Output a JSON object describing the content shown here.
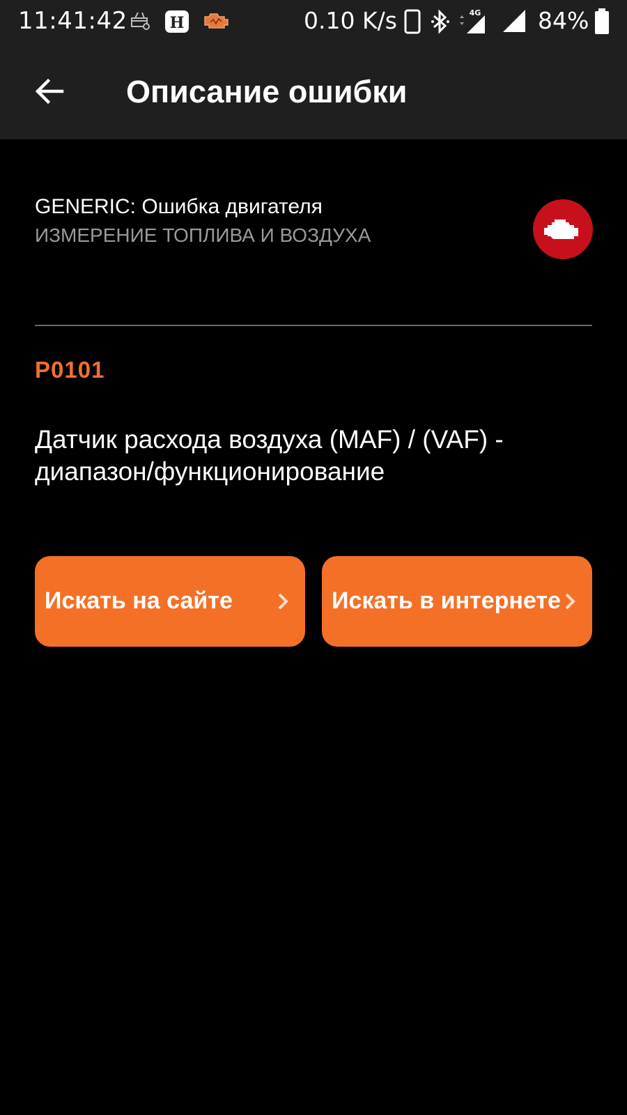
{
  "status_bar": {
    "time": "11:41:42",
    "net_speed": "0.10 K/s",
    "network_type": "4G",
    "battery": "84%",
    "notification_icons": [
      "basket-icon",
      "h-app-icon",
      "check-engine-app-icon"
    ],
    "system_icons": [
      "phone-icon",
      "bluetooth-icon",
      "signal-4g-icon",
      "signal-icon",
      "battery-icon"
    ]
  },
  "app_bar": {
    "title": "Описание ошибки",
    "back_icon": "arrow-left-icon"
  },
  "error": {
    "source": "GENERIC: Ошибка двигателя",
    "category": "ИЗМЕРЕНИЕ ТОПЛИВА И ВОЗДУХА",
    "badge_icon": "check-engine-icon",
    "code": "P0101",
    "description": "Датчик расхода воздуха (MAF) / (VAF) - диапазон/функционирование"
  },
  "actions": {
    "search_site": "Искать на сайте",
    "search_web": "Искать в интернете",
    "chevron_icon": "chevron-right-icon"
  },
  "colors": {
    "accent": "#f47027",
    "code_color": "#f07030",
    "badge_red": "#c8101c",
    "app_bar_bg": "#1f1f1f",
    "background": "#000000"
  }
}
